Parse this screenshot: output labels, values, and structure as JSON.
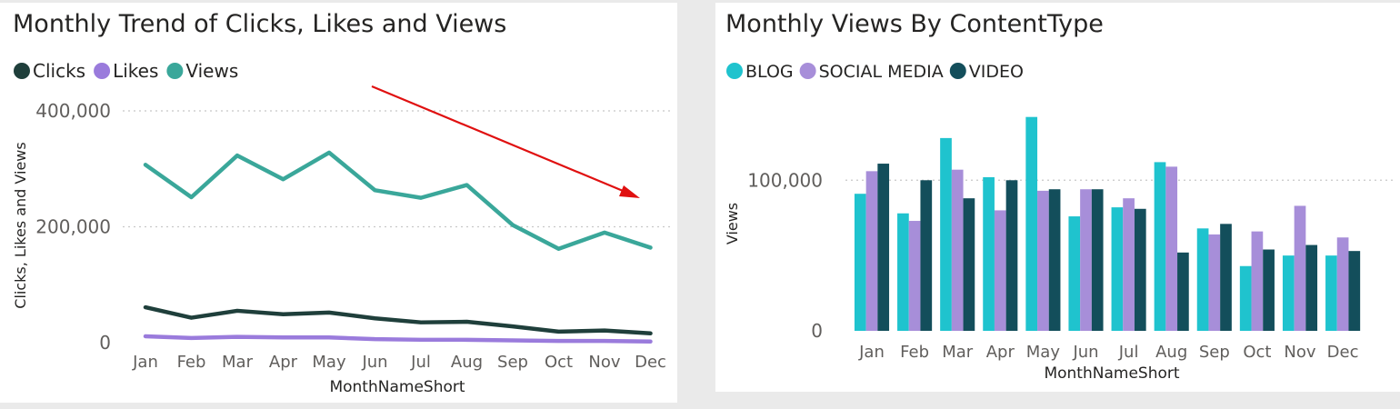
{
  "colors": {
    "clicks": "#1f3f3b",
    "likes": "#9a7bdc",
    "views": "#3aa79a",
    "blog": "#1fc3ce",
    "social_media": "#a78ed9",
    "video": "#134e5b",
    "arrow": "#e01010",
    "text": "#252423",
    "tick": "#605e5c",
    "grid": "#c8c8c8"
  },
  "chart_data": [
    {
      "type": "line",
      "title": "Monthly Trend of Clicks, Likes and Views",
      "xlabel": "MonthNameShort",
      "ylabel": "Clicks, Likes and Views",
      "ylim": [
        0,
        400000
      ],
      "yticks": [
        0,
        200000,
        400000
      ],
      "ytick_labels": [
        "0",
        "200,000",
        "400,000"
      ],
      "grid": true,
      "legend": "top-left",
      "categories": [
        "Jan",
        "Feb",
        "Mar",
        "Apr",
        "May",
        "Jun",
        "Jul",
        "Aug",
        "Sep",
        "Oct",
        "Nov",
        "Dec"
      ],
      "series": [
        {
          "name": "Clicks",
          "color_key": "clicks",
          "values": [
            61000,
            43000,
            55000,
            49000,
            52000,
            42000,
            35000,
            36000,
            28000,
            19000,
            21000,
            16000
          ]
        },
        {
          "name": "Likes",
          "color_key": "likes",
          "values": [
            11000,
            8000,
            10000,
            9000,
            9000,
            6000,
            5000,
            5000,
            4000,
            3000,
            3000,
            2000
          ]
        },
        {
          "name": "Views",
          "color_key": "views",
          "values": [
            307000,
            251000,
            323000,
            282000,
            328000,
            263000,
            250000,
            272000,
            203000,
            162000,
            190000,
            164000
          ]
        }
      ],
      "annotation": {
        "type": "trend-arrow",
        "direction": "down"
      }
    },
    {
      "type": "bar",
      "title": "Monthly Views By ContentType",
      "xlabel": "MonthNameShort",
      "ylabel": "Views",
      "ylim": [
        0,
        140000
      ],
      "yticks": [
        0,
        100000
      ],
      "ytick_labels": [
        "0",
        "100,000"
      ],
      "grid": true,
      "legend": "top-left",
      "categories": [
        "Jan",
        "Feb",
        "Mar",
        "Apr",
        "May",
        "Jun",
        "Jul",
        "Aug",
        "Sep",
        "Oct",
        "Nov",
        "Dec"
      ],
      "series": [
        {
          "name": "BLOG",
          "color_key": "blog",
          "values": [
            91000,
            78000,
            128000,
            102000,
            142000,
            76000,
            82000,
            112000,
            68000,
            43000,
            50000,
            50000
          ]
        },
        {
          "name": "SOCIAL MEDIA",
          "color_key": "social_media",
          "values": [
            106000,
            73000,
            107000,
            80000,
            93000,
            94000,
            88000,
            109000,
            64000,
            66000,
            83000,
            62000
          ]
        },
        {
          "name": "VIDEO",
          "color_key": "video",
          "values": [
            111000,
            100000,
            88000,
            100000,
            94000,
            94000,
            81000,
            52000,
            71000,
            54000,
            57000,
            53000
          ]
        }
      ]
    }
  ]
}
